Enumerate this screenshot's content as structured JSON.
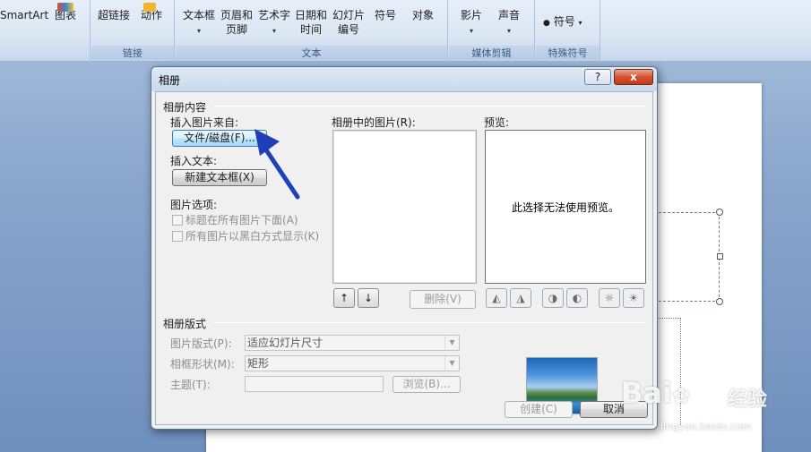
{
  "ribbon": {
    "groups": [
      {
        "label": ""
      },
      {
        "label": "链接"
      },
      {
        "label": "文本"
      },
      {
        "label": "媒体剪辑"
      },
      {
        "label": "特殊符号"
      }
    ],
    "buttons": {
      "smartart": "SmartArt",
      "chart": "图表",
      "hyperlink": "超链接",
      "action": "动作",
      "textbox_l1": "文本框",
      "header_l1": "页眉和",
      "header_l2": "页脚",
      "wordart": "艺术字",
      "datetime_l1": "日期和",
      "datetime_l2": "时间",
      "slidenum_l1": "幻灯片",
      "slidenum_l2": "编号",
      "symbol": "符号",
      "object": "对象",
      "movie": "影片",
      "sound": "声音",
      "special_symbol": "符号"
    },
    "dropdown_glyph": "▾"
  },
  "dialog": {
    "title": "相册",
    "help": "?",
    "close": "x",
    "album_content": "相册内容",
    "insert_picture_from": "插入图片来自:",
    "file_disk": "文件/磁盘(F)...",
    "insert_text": "插入文本:",
    "new_text_box": "新建文本框(X)",
    "picture_options": "图片选项:",
    "captions_below": "标题在所有图片下面(A)",
    "all_black_white": "所有图片以黑白方式显示(K)",
    "pictures_in_album": "相册中的图片(R):",
    "preview": "预览:",
    "preview_message": "此选择无法使用预览。",
    "remove": "删除(V)",
    "move_up": "↑",
    "move_down": "↓",
    "rotate_left": "◭",
    "rotate_right": "◮",
    "contrast_up": "◑",
    "contrast_down": "◐",
    "brightness_up": "☼",
    "brightness_down": "☀",
    "album_layout": "相册版式",
    "picture_layout_label": "图片版式(P):",
    "picture_layout_value": "适应幻灯片尺寸",
    "frame_shape_label": "相框形状(M):",
    "frame_shape_value": "矩形",
    "theme_label": "主题(T):",
    "browse": "浏览(B)...",
    "create": "创建(C)",
    "cancel": "取消"
  },
  "watermark": {
    "brand_latin": "Bai",
    "brand_cn": "经验",
    "url": "jingyan.baidu.com"
  }
}
